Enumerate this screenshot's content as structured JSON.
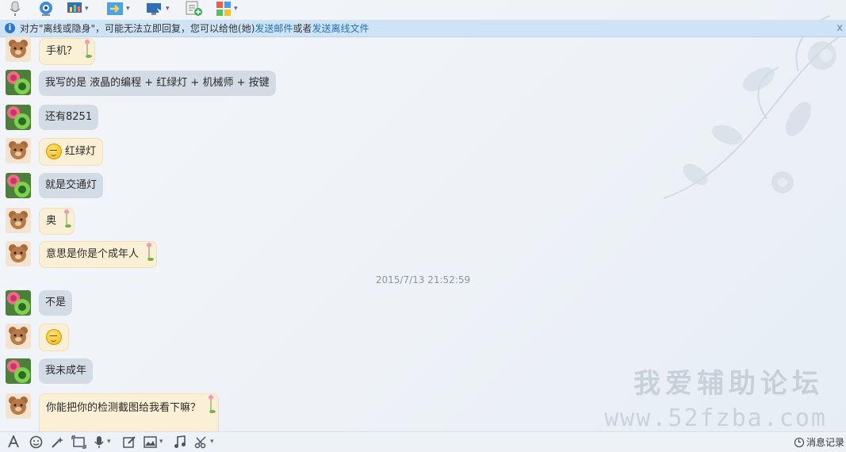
{
  "toolbar": {
    "items": [
      {
        "icon": "microphone-icon"
      },
      {
        "icon": "webcam-icon"
      },
      {
        "icon": "screen-share-icon",
        "caret": "▾"
      },
      {
        "icon": "transfer-file-icon",
        "caret": "▾"
      },
      {
        "icon": "remote-assist-icon",
        "caret": "▾"
      },
      {
        "icon": "add-note-icon"
      },
      {
        "icon": "apps-icon",
        "caret": "▾"
      }
    ]
  },
  "notice": {
    "text": "对方\"离线或隐身\"，可能无法立即回复，您可以给他(她)",
    "link_email": "发送邮件",
    "or": "或者",
    "link_offline_file": "发送离线文件",
    "close": "x"
  },
  "messages": [
    {
      "id": "m1",
      "sender": "bear",
      "text": "手机？",
      "style": "cream"
    },
    {
      "id": "m2",
      "sender": "flower",
      "text": "我写的是  液晶的编程 + 红绿灯 + 机械师 + 按键",
      "style": "grey"
    },
    {
      "id": "m3",
      "sender": "flower",
      "text": "还有8251",
      "style": "grey"
    },
    {
      "id": "m4",
      "sender": "bear",
      "text": "红绿灯",
      "style": "cream",
      "emoji": true
    },
    {
      "id": "m5",
      "sender": "flower",
      "text": "就是交通灯",
      "style": "grey"
    },
    {
      "id": "m6",
      "sender": "bear",
      "text": "奥",
      "style": "cream"
    },
    {
      "id": "m7",
      "sender": "bear",
      "text": "意思是你是个成年人",
      "style": "cream"
    },
    {
      "id": "m8",
      "sender": "flower",
      "text": "不是",
      "style": "grey"
    },
    {
      "id": "m9",
      "sender": "bear",
      "text": "",
      "style": "cream",
      "emoji": true
    },
    {
      "id": "m10",
      "sender": "flower",
      "text": "我未成年",
      "style": "grey"
    },
    {
      "id": "m11",
      "sender": "bear",
      "text": "你能把你的检测截图给我看下嘛？",
      "style": "cream"
    }
  ],
  "timestamp": "2015/7/13 21:52:59",
  "watermark": {
    "title": "我爱辅助论坛",
    "url": "www.52fzba.com"
  },
  "bottom_toolbar": {
    "items": [
      "font-icon",
      "emoji-icon",
      "magic-wand-icon",
      "screenshot-icon",
      "voice-icon",
      "edit-icon",
      "image-icon",
      "music-icon",
      "scissors-icon"
    ],
    "history_label": "消息记录"
  }
}
